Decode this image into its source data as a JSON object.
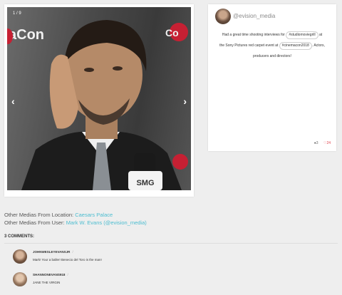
{
  "media": {
    "counter": "1 / 9",
    "backdrop_left": "aCon",
    "backdrop_right": "Co",
    "mic_label": "SMG"
  },
  "post": {
    "username": "@evision_media",
    "text_1": "Had a great time shooting interviews for",
    "tag_1": "#studiomoviegrill",
    "text_2": "at",
    "text_3": "the Sony Pictures red carpet event at",
    "tag_2": "#cinemacon2018",
    "text_4": ". Actors,",
    "text_5": "producers and directors!",
    "comments_count": "3",
    "likes_count": "24"
  },
  "info": {
    "location_prefix": "Other Medias From Location:",
    "location_link": "Caesars Palace",
    "user_prefix": "Other Medias From User:",
    "user_link": "Mark W. Evans (@evision_media)"
  },
  "comments": {
    "heading": "3 COMMENTS:",
    "items": [
      {
        "user": "JOHNWESLEYEVANSJR",
        "text": "Mark! Your a baller! Benecio del Toro is the man!"
      },
      {
        "user": "SHANNONEVANS918",
        "text": "JANE THE VIRGIN"
      }
    ]
  },
  "colors": {
    "link": "#4dbdd0",
    "heart": "#e0434d",
    "brand_red": "#c62033"
  }
}
